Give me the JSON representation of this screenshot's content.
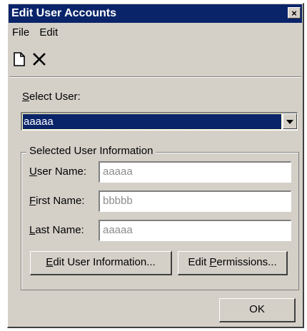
{
  "window": {
    "title": "Edit User Accounts",
    "close_glyph": "×"
  },
  "menu": [
    {
      "label": "File"
    },
    {
      "label": "Edit"
    }
  ],
  "toolbar": {
    "items": [
      {
        "icon": "new-document-icon"
      },
      {
        "icon": "delete-x-icon"
      }
    ]
  },
  "select_user": {
    "label": "Select User:",
    "accesskey": "S",
    "rest": "elect User:",
    "value": "aaaaa"
  },
  "group": {
    "title": "Selected User Information"
  },
  "fields": {
    "username": {
      "ak": "U",
      "rest": "ser Name:",
      "value": "aaaaa"
    },
    "firstname": {
      "ak": "F",
      "rest": "irst Name:",
      "value": "bbbbb"
    },
    "lastname": {
      "ak": "L",
      "rest": "ast Name:",
      "value": "aaaaa"
    }
  },
  "buttons": {
    "edit_info": {
      "ak": "E",
      "rest": "dit User Information..."
    },
    "edit_perm": {
      "pre": "Edit ",
      "ak": "P",
      "rest": "ermissions..."
    },
    "ok": {
      "label": "OK"
    }
  },
  "colors": {
    "title_bg": "#0a246a",
    "face": "#d4d0c8",
    "disabled_text": "#8c8c8c"
  }
}
